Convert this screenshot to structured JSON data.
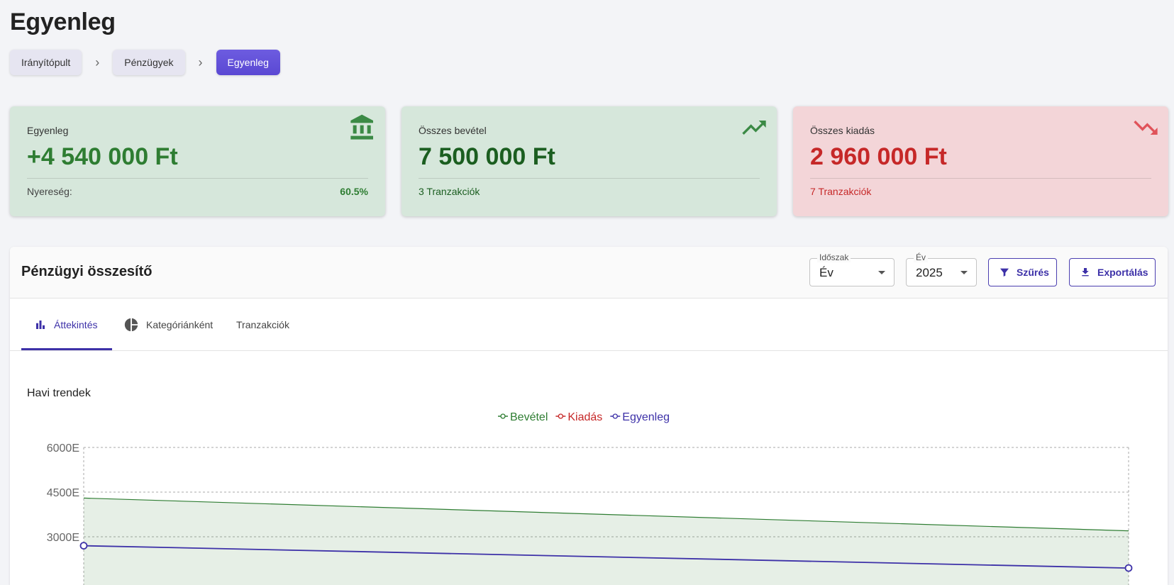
{
  "page": {
    "title": "Egyenleg"
  },
  "breadcrumb": {
    "items": [
      "Irányítópult",
      "Pénzügyek",
      "Egyenleg"
    ],
    "separator": "›"
  },
  "cards": {
    "balance": {
      "label": "Egyenleg",
      "value": "+4 540 000 Ft",
      "foot_label": "Nyereség:",
      "foot_value": "60.5%",
      "icon": "bank-icon",
      "bg": "#d6e7db",
      "color": "#2e7d32"
    },
    "income": {
      "label": "Összes bevétel",
      "value": "7 500 000 Ft",
      "foot": "3 Tranzakciók",
      "icon": "trending-up-icon",
      "bg": "#d6e7db",
      "color": "#1b5e20"
    },
    "expense": {
      "label": "Összes kiadás",
      "value": "2 960 000 Ft",
      "foot": "7 Tranzakciók",
      "icon": "trending-down-icon",
      "bg": "#f3d5d8",
      "color": "#c62828"
    }
  },
  "panel": {
    "title": "Pénzügyi összesítő",
    "period": {
      "label": "Időszak",
      "value": "Év"
    },
    "year": {
      "label": "Év",
      "value": "2025"
    },
    "filter_label": "Szűrés",
    "export_label": "Exportálás",
    "tabs": [
      {
        "label": "Áttekintés",
        "icon": "bar-chart-icon",
        "active": true
      },
      {
        "label": "Kategóriánként",
        "icon": "pie-chart-icon",
        "active": false
      },
      {
        "label": "Tranzakciók",
        "active": false
      }
    ],
    "accent": "#3d31a8"
  },
  "chart_title": "Havi trendek",
  "chart_data": {
    "type": "line",
    "title": "Havi trendek",
    "ytick_labels": [
      "6000E",
      "4500E",
      "3000E"
    ],
    "ylim": [
      1800,
      6000
    ],
    "x_points": 2,
    "series": [
      {
        "name": "Bevétel",
        "color": "#2e7d32",
        "values": [
          4300,
          3200
        ],
        "fill": true
      },
      {
        "name": "Kiadás",
        "color": "#c62828",
        "values": []
      },
      {
        "name": "Egyenleg",
        "color": "#3d31a8",
        "values": [
          2700,
          1950
        ]
      }
    ],
    "grid": true,
    "legend": "top-center"
  }
}
